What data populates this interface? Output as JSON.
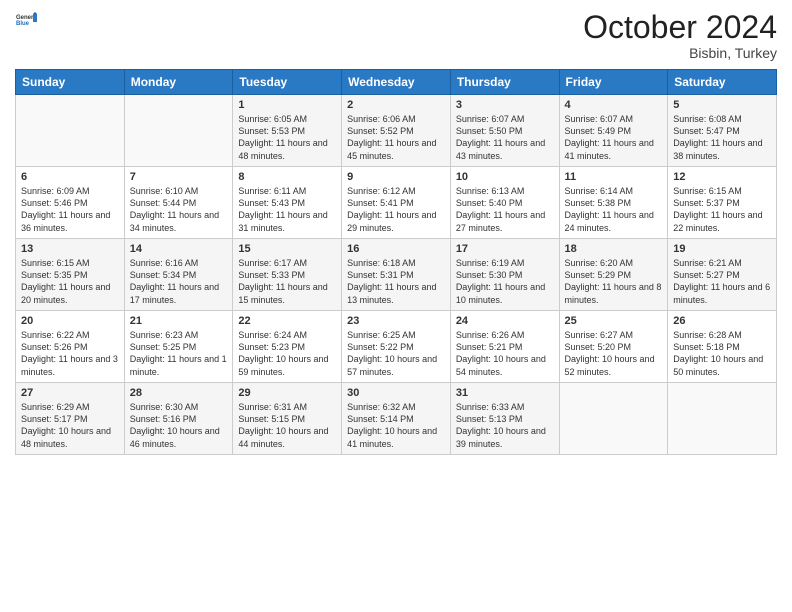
{
  "header": {
    "logo_general": "General",
    "logo_blue": "Blue",
    "month_title": "October 2024",
    "location": "Bisbin, Turkey"
  },
  "days_of_week": [
    "Sunday",
    "Monday",
    "Tuesday",
    "Wednesday",
    "Thursday",
    "Friday",
    "Saturday"
  ],
  "weeks": [
    [
      {
        "day": "",
        "info": ""
      },
      {
        "day": "",
        "info": ""
      },
      {
        "day": "1",
        "info": "Sunrise: 6:05 AM\nSunset: 5:53 PM\nDaylight: 11 hours and 48 minutes."
      },
      {
        "day": "2",
        "info": "Sunrise: 6:06 AM\nSunset: 5:52 PM\nDaylight: 11 hours and 45 minutes."
      },
      {
        "day": "3",
        "info": "Sunrise: 6:07 AM\nSunset: 5:50 PM\nDaylight: 11 hours and 43 minutes."
      },
      {
        "day": "4",
        "info": "Sunrise: 6:07 AM\nSunset: 5:49 PM\nDaylight: 11 hours and 41 minutes."
      },
      {
        "day": "5",
        "info": "Sunrise: 6:08 AM\nSunset: 5:47 PM\nDaylight: 11 hours and 38 minutes."
      }
    ],
    [
      {
        "day": "6",
        "info": "Sunrise: 6:09 AM\nSunset: 5:46 PM\nDaylight: 11 hours and 36 minutes."
      },
      {
        "day": "7",
        "info": "Sunrise: 6:10 AM\nSunset: 5:44 PM\nDaylight: 11 hours and 34 minutes."
      },
      {
        "day": "8",
        "info": "Sunrise: 6:11 AM\nSunset: 5:43 PM\nDaylight: 11 hours and 31 minutes."
      },
      {
        "day": "9",
        "info": "Sunrise: 6:12 AM\nSunset: 5:41 PM\nDaylight: 11 hours and 29 minutes."
      },
      {
        "day": "10",
        "info": "Sunrise: 6:13 AM\nSunset: 5:40 PM\nDaylight: 11 hours and 27 minutes."
      },
      {
        "day": "11",
        "info": "Sunrise: 6:14 AM\nSunset: 5:38 PM\nDaylight: 11 hours and 24 minutes."
      },
      {
        "day": "12",
        "info": "Sunrise: 6:15 AM\nSunset: 5:37 PM\nDaylight: 11 hours and 22 minutes."
      }
    ],
    [
      {
        "day": "13",
        "info": "Sunrise: 6:15 AM\nSunset: 5:35 PM\nDaylight: 11 hours and 20 minutes."
      },
      {
        "day": "14",
        "info": "Sunrise: 6:16 AM\nSunset: 5:34 PM\nDaylight: 11 hours and 17 minutes."
      },
      {
        "day": "15",
        "info": "Sunrise: 6:17 AM\nSunset: 5:33 PM\nDaylight: 11 hours and 15 minutes."
      },
      {
        "day": "16",
        "info": "Sunrise: 6:18 AM\nSunset: 5:31 PM\nDaylight: 11 hours and 13 minutes."
      },
      {
        "day": "17",
        "info": "Sunrise: 6:19 AM\nSunset: 5:30 PM\nDaylight: 11 hours and 10 minutes."
      },
      {
        "day": "18",
        "info": "Sunrise: 6:20 AM\nSunset: 5:29 PM\nDaylight: 11 hours and 8 minutes."
      },
      {
        "day": "19",
        "info": "Sunrise: 6:21 AM\nSunset: 5:27 PM\nDaylight: 11 hours and 6 minutes."
      }
    ],
    [
      {
        "day": "20",
        "info": "Sunrise: 6:22 AM\nSunset: 5:26 PM\nDaylight: 11 hours and 3 minutes."
      },
      {
        "day": "21",
        "info": "Sunrise: 6:23 AM\nSunset: 5:25 PM\nDaylight: 11 hours and 1 minute."
      },
      {
        "day": "22",
        "info": "Sunrise: 6:24 AM\nSunset: 5:23 PM\nDaylight: 10 hours and 59 minutes."
      },
      {
        "day": "23",
        "info": "Sunrise: 6:25 AM\nSunset: 5:22 PM\nDaylight: 10 hours and 57 minutes."
      },
      {
        "day": "24",
        "info": "Sunrise: 6:26 AM\nSunset: 5:21 PM\nDaylight: 10 hours and 54 minutes."
      },
      {
        "day": "25",
        "info": "Sunrise: 6:27 AM\nSunset: 5:20 PM\nDaylight: 10 hours and 52 minutes."
      },
      {
        "day": "26",
        "info": "Sunrise: 6:28 AM\nSunset: 5:18 PM\nDaylight: 10 hours and 50 minutes."
      }
    ],
    [
      {
        "day": "27",
        "info": "Sunrise: 6:29 AM\nSunset: 5:17 PM\nDaylight: 10 hours and 48 minutes."
      },
      {
        "day": "28",
        "info": "Sunrise: 6:30 AM\nSunset: 5:16 PM\nDaylight: 10 hours and 46 minutes."
      },
      {
        "day": "29",
        "info": "Sunrise: 6:31 AM\nSunset: 5:15 PM\nDaylight: 10 hours and 44 minutes."
      },
      {
        "day": "30",
        "info": "Sunrise: 6:32 AM\nSunset: 5:14 PM\nDaylight: 10 hours and 41 minutes."
      },
      {
        "day": "31",
        "info": "Sunrise: 6:33 AM\nSunset: 5:13 PM\nDaylight: 10 hours and 39 minutes."
      },
      {
        "day": "",
        "info": ""
      },
      {
        "day": "",
        "info": ""
      }
    ]
  ]
}
